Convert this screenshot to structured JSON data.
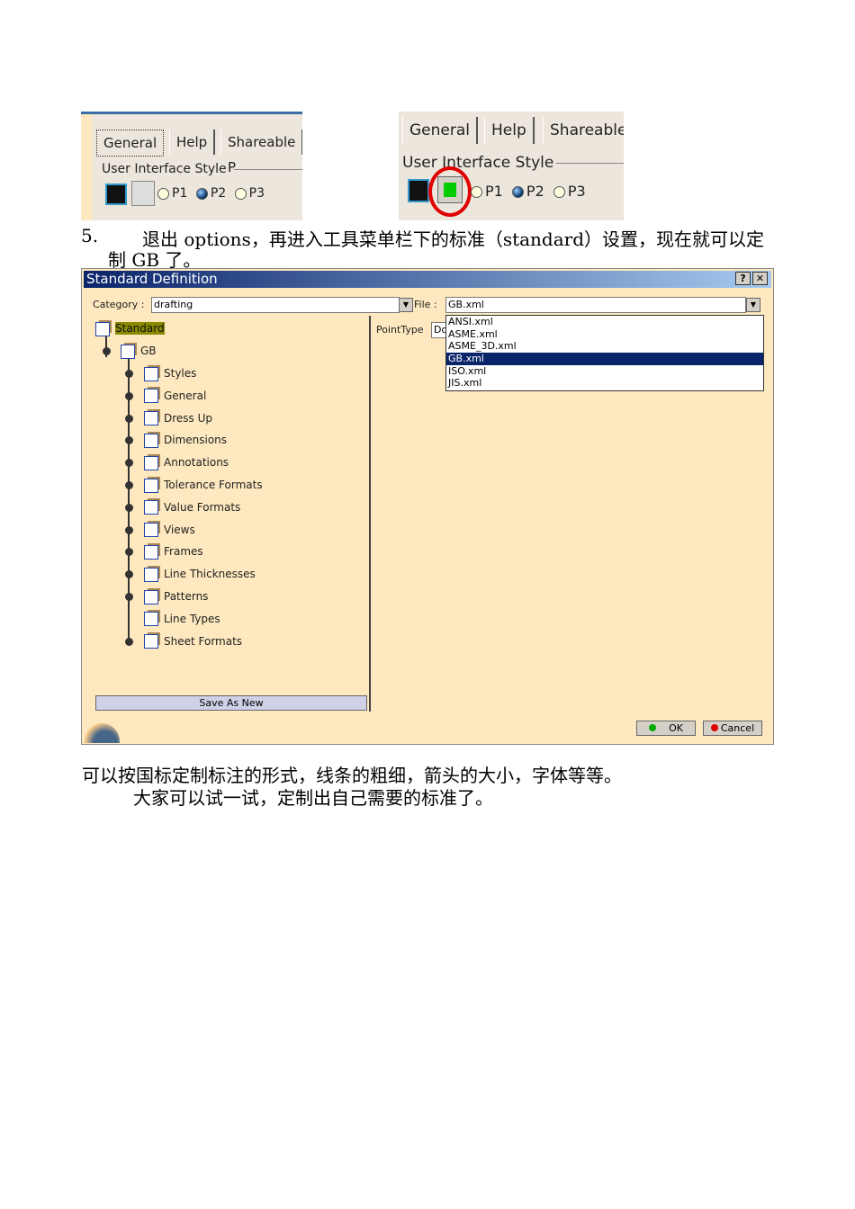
{
  "shot_left": {
    "tabs": [
      "General",
      "Help",
      "Shareable P"
    ],
    "group": "User Interface Style",
    "radios": [
      {
        "label": "P1",
        "checked": false
      },
      {
        "label": "P2",
        "checked": true
      },
      {
        "label": "P3",
        "checked": false
      }
    ]
  },
  "shot_right": {
    "tabs": [
      "General",
      "Help",
      "Shareable"
    ],
    "group": "User Interface Style",
    "radios": [
      {
        "label": "P1",
        "checked": false
      },
      {
        "label": "P2",
        "checked": true
      },
      {
        "label": "P3",
        "checked": false
      }
    ],
    "highlight_color": "#e00000"
  },
  "step": {
    "number": "5.",
    "line1": "退出 options，再进入工具菜单栏下的标准（standard）设置，现在就可以定",
    "line2": "制 GB 了。"
  },
  "dialog": {
    "title": "Standard Definition",
    "help_btn": "?",
    "close_btn": "✕",
    "category_label": "Category :",
    "category_value": "drafting",
    "file_label": "File :",
    "file_value": "GB.xml",
    "pointtype_label": "PointType",
    "pointtype_value": "Do",
    "file_options": [
      "ANSI.xml",
      "ASME.xml",
      "ASME_3D.xml",
      "GB.xml",
      "ISO.xml",
      "JIS.xml"
    ],
    "selected_option": "GB.xml",
    "tree_root": "Standard",
    "tree_gb": "GB",
    "tree_children": [
      "Styles",
      "General",
      "Dress Up",
      "Dimensions",
      "Annotations",
      "Tolerance Formats",
      "Value Formats",
      "Views",
      "Frames",
      "Line Thicknesses",
      "Patterns",
      "Line Types",
      "Sheet Formats"
    ],
    "save_as_new": "Save As New",
    "ok": "OK",
    "cancel": "Cancel"
  },
  "para": {
    "line1": "可以按国标定制标注的形式，线条的粗细，箭头的大小，字体等等。",
    "line2": "大家可以试一试，定制出自己需要的标准了。"
  }
}
